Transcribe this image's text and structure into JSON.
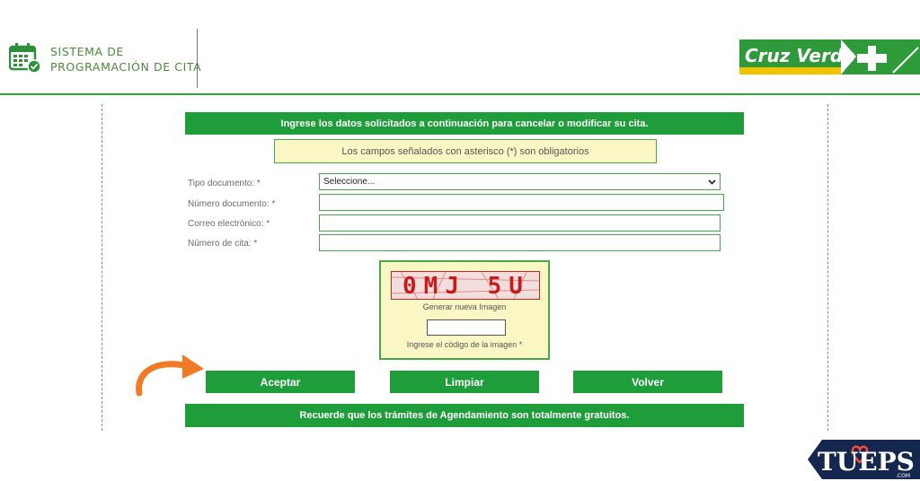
{
  "header": {
    "title_line1": "SISTEMA DE",
    "title_line2": "PROGRAMACIÓN DE CITA",
    "brand_name": "Cruz Verde"
  },
  "form": {
    "top_banner": "Ingrese los datos solicitados a continuación para cancelar o modificar su cita.",
    "required_notice": "Los campos señalados con asterisco (*) son obligatorios",
    "fields": [
      {
        "label": "Tipo documento: *",
        "value": "Seleccione..."
      },
      {
        "label": "Número documento: *",
        "value": ""
      },
      {
        "label": "Correo electrónico: *",
        "value": ""
      },
      {
        "label": "Número de cita: *",
        "value": ""
      }
    ],
    "captcha": {
      "code": "0MJ 5U",
      "new_image_link": "Generar nueva Imagen",
      "input_label": "Ingrese el código de la imagen *",
      "input_value": ""
    },
    "buttons": {
      "accept": "Aceptar",
      "clear": "Limpiar",
      "back": "Volver"
    },
    "bottom_banner": "Recuerde que los trámites de Agendamiento son totalmente gratuitos."
  },
  "watermark": {
    "text": "TUEPS",
    "suffix": ".COM"
  },
  "colors": {
    "brand_green": "#1f9d3a",
    "notice_yellow": "#fbf7c4",
    "arrow_orange": "#f07a25",
    "badge_navy": "#14284f"
  }
}
